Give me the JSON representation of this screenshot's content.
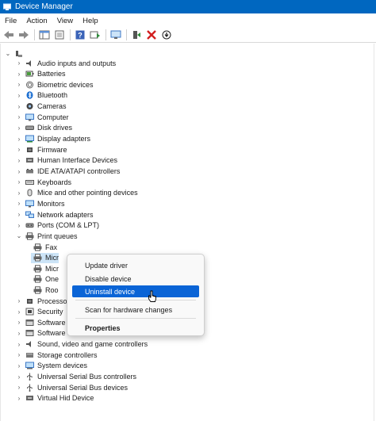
{
  "window": {
    "title": "Device Manager"
  },
  "menubar": {
    "items": [
      "File",
      "Action",
      "View",
      "Help"
    ]
  },
  "toolbar": {
    "buttons": [
      "back-icon",
      "forward-icon",
      "show-hide-console-tree-icon",
      "properties-icon",
      "help-icon",
      "update-driver-icon",
      "scan-hardware-icon",
      "add-legacy-hardware-icon",
      "uninstall-icon",
      "disable-icon"
    ],
    "accent": "#0067c0"
  },
  "tree": {
    "root_label": "",
    "categories": [
      {
        "label": "Audio inputs and outputs",
        "icon": "speaker-icon"
      },
      {
        "label": "Batteries",
        "icon": "battery-icon"
      },
      {
        "label": "Biometric devices",
        "icon": "fingerprint-icon"
      },
      {
        "label": "Bluetooth",
        "icon": "bluetooth-icon"
      },
      {
        "label": "Cameras",
        "icon": "camera-icon"
      },
      {
        "label": "Computer",
        "icon": "monitor-icon"
      },
      {
        "label": "Disk drives",
        "icon": "disk-drive-icon"
      },
      {
        "label": "Display adapters",
        "icon": "display-adapter-icon"
      },
      {
        "label": "Firmware",
        "icon": "chip-icon"
      },
      {
        "label": "Human Interface Devices",
        "icon": "hid-icon"
      },
      {
        "label": "IDE ATA/ATAPI controllers",
        "icon": "controller-icon"
      },
      {
        "label": "Keyboards",
        "icon": "keyboard-icon"
      },
      {
        "label": "Mice and other pointing devices",
        "icon": "mouse-icon"
      },
      {
        "label": "Monitors",
        "icon": "monitor-icon"
      },
      {
        "label": "Network adapters",
        "icon": "network-icon"
      },
      {
        "label": "Ports (COM & LPT)",
        "icon": "port-icon"
      },
      {
        "label": "Print queues",
        "icon": "printer-icon",
        "expanded": true
      }
    ],
    "print_queue_children": [
      {
        "label": "Fax"
      },
      {
        "label": "Micr",
        "selected": true
      },
      {
        "label": "Micr"
      },
      {
        "label": "One"
      },
      {
        "label": "Roo"
      }
    ],
    "categories_after": [
      {
        "label": "Processo",
        "icon": "chip-icon"
      },
      {
        "label": "Security",
        "icon": "security-icon"
      },
      {
        "label": "Software",
        "icon": "software-icon"
      },
      {
        "label": "Software",
        "icon": "software-icon"
      },
      {
        "label": "Sound, video and game controllers",
        "icon": "speaker-icon"
      },
      {
        "label": "Storage controllers",
        "icon": "storage-icon"
      },
      {
        "label": "System devices",
        "icon": "system-icon"
      },
      {
        "label": "Universal Serial Bus controllers",
        "icon": "usb-icon"
      },
      {
        "label": "Universal Serial Bus devices",
        "icon": "usb-icon"
      },
      {
        "label": "Virtual Hid Device",
        "icon": "hid-icon"
      }
    ]
  },
  "context_menu": {
    "items": [
      "Update driver",
      "Disable device",
      "Uninstall device",
      "Scan for hardware changes",
      "Properties"
    ],
    "highlighted": "Uninstall device",
    "highlight_color": "#0a64d6"
  }
}
